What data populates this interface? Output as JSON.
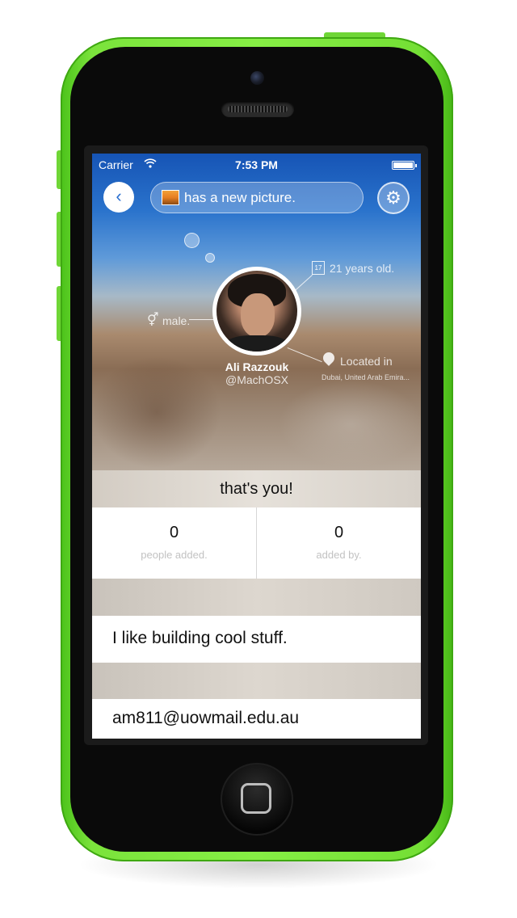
{
  "status_bar": {
    "carrier": "Carrier",
    "time": "7:53 PM",
    "wifi_icon": "wifi-icon",
    "battery_icon": "battery-icon"
  },
  "nav": {
    "back_icon": "chevron-left-icon",
    "back_glyph": "‹",
    "status_text": "has a new picture.",
    "status_image_icon": "picture-icon",
    "settings_icon": "gear-icon",
    "settings_glyph": "⚙"
  },
  "profile": {
    "name": "Ali Razzouk",
    "handle": "@MachOSX",
    "age": "21 years old.",
    "calendar_day": "17",
    "gender": "male.",
    "gender_glyph": "⚥",
    "location_label": "Located in",
    "location_value": "Dubai, United Arab Emira..."
  },
  "self_banner": "that's you!",
  "stats": [
    {
      "value": "0",
      "label": "people added."
    },
    {
      "value": "0",
      "label": "added by."
    }
  ],
  "bio": "I like building cool stuff.",
  "email": "am811@uowmail.edu.au",
  "colors": {
    "device": "#7be33c",
    "sky_top": "#1654b5",
    "back_arrow": "#2a6fd0"
  }
}
